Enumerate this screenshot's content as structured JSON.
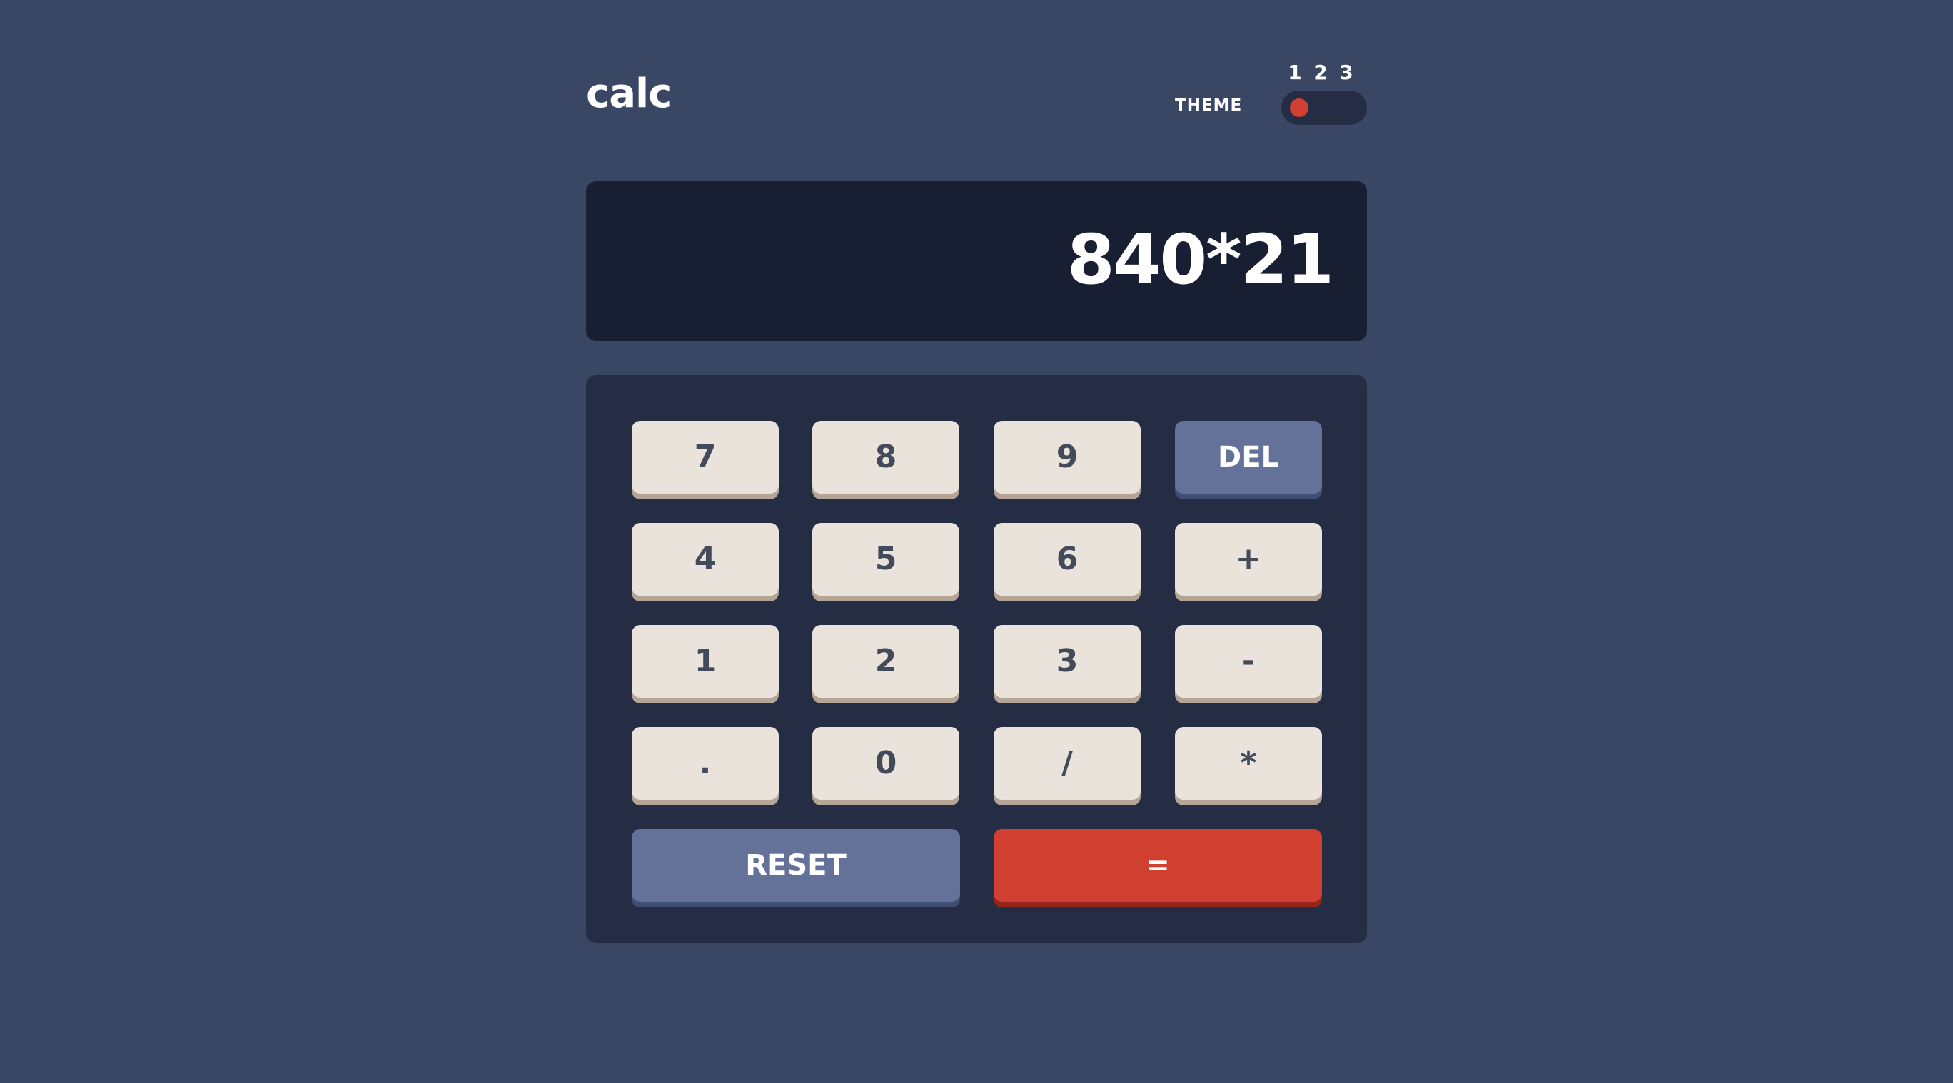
{
  "header": {
    "logo": "calc",
    "theme_label": "THEME",
    "theme_options": [
      "1",
      "2",
      "3"
    ],
    "selected_theme": 1
  },
  "display": {
    "value": "840*21"
  },
  "keypad": {
    "keys": {
      "seven": "7",
      "eight": "8",
      "nine": "9",
      "del": "DEL",
      "four": "4",
      "five": "5",
      "six": "6",
      "plus": "+",
      "one": "1",
      "two": "2",
      "three": "3",
      "minus": "-",
      "decimal": ".",
      "zero": "0",
      "divide": "/",
      "multiply": "*",
      "reset": "RESET",
      "equals": "="
    }
  },
  "colors": {
    "main_background": "#3a4764",
    "keypad_background": "#242d44",
    "screen_background": "#181f33",
    "key_background": "#eae3dc",
    "key_text": "#434a59",
    "accent_blue": "#647198",
    "accent_red": "#d03f2f"
  }
}
